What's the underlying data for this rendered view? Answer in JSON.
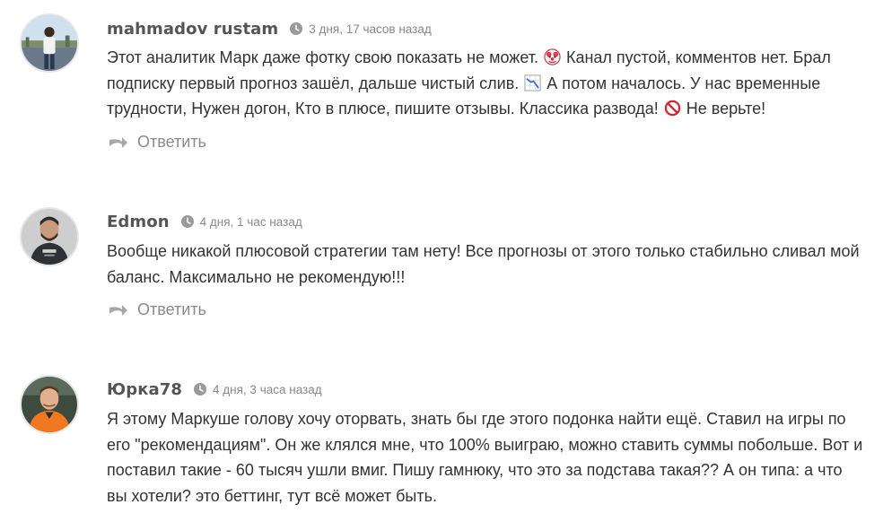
{
  "comments": [
    {
      "author": "mahmadov rustam",
      "time": "3 дня, 17 часов назад",
      "text_parts": [
        "Этот аналитик Марк даже фотку свою показать не может. ",
        " Канал пустой, комментов нет. Брал подписку первый прогноз зашёл, дальше чистый слив. ",
        " А потом началось. У нас временные трудности, Нужен догон, Кто в плюсе, пишите отзывы. Классика развода! ",
        " Не верьте!"
      ],
      "emojis": [
        "clown-face-icon",
        "chart-decreasing-icon",
        "prohibited-icon"
      ],
      "reply_label": "Ответить",
      "avatar_icon": "user-photo-man-outdoors"
    },
    {
      "author": "Edmon",
      "time": "4 дня, 1 час назад",
      "text_parts": [
        "Вообще никакой плюсовой стратегии там нету! Все прогнозы от этого только стабильно сливал мой баланс. Максимально не рекомендую!!!"
      ],
      "reply_label": "Ответить",
      "avatar_icon": "user-photo-man-bearded"
    },
    {
      "author": "Юрка78",
      "time": "4 дня, 3 часа назад",
      "text_parts": [
        "Я этому Маркуше голову хочу оторвать, знать бы где этого подонка найти ещё. Ставил на игры по его \"рекомендациям\". Он же клялся мне, что 100% выиграю, можно ставить суммы побольше. Вот и поставил такие - 60 тысяч ушли вмиг. Пишу гамнюку, что это за подстава такая?? А он типа: а что вы хотели? это беттинг, тут всё может быть."
      ],
      "avatar_icon": "user-photo-man-orange-jacket"
    }
  ],
  "colors": {
    "author": "#555555",
    "time": "#888888",
    "text": "#333333",
    "reply": "#8a8a8a",
    "avatar_border": "#e6e6e6"
  }
}
